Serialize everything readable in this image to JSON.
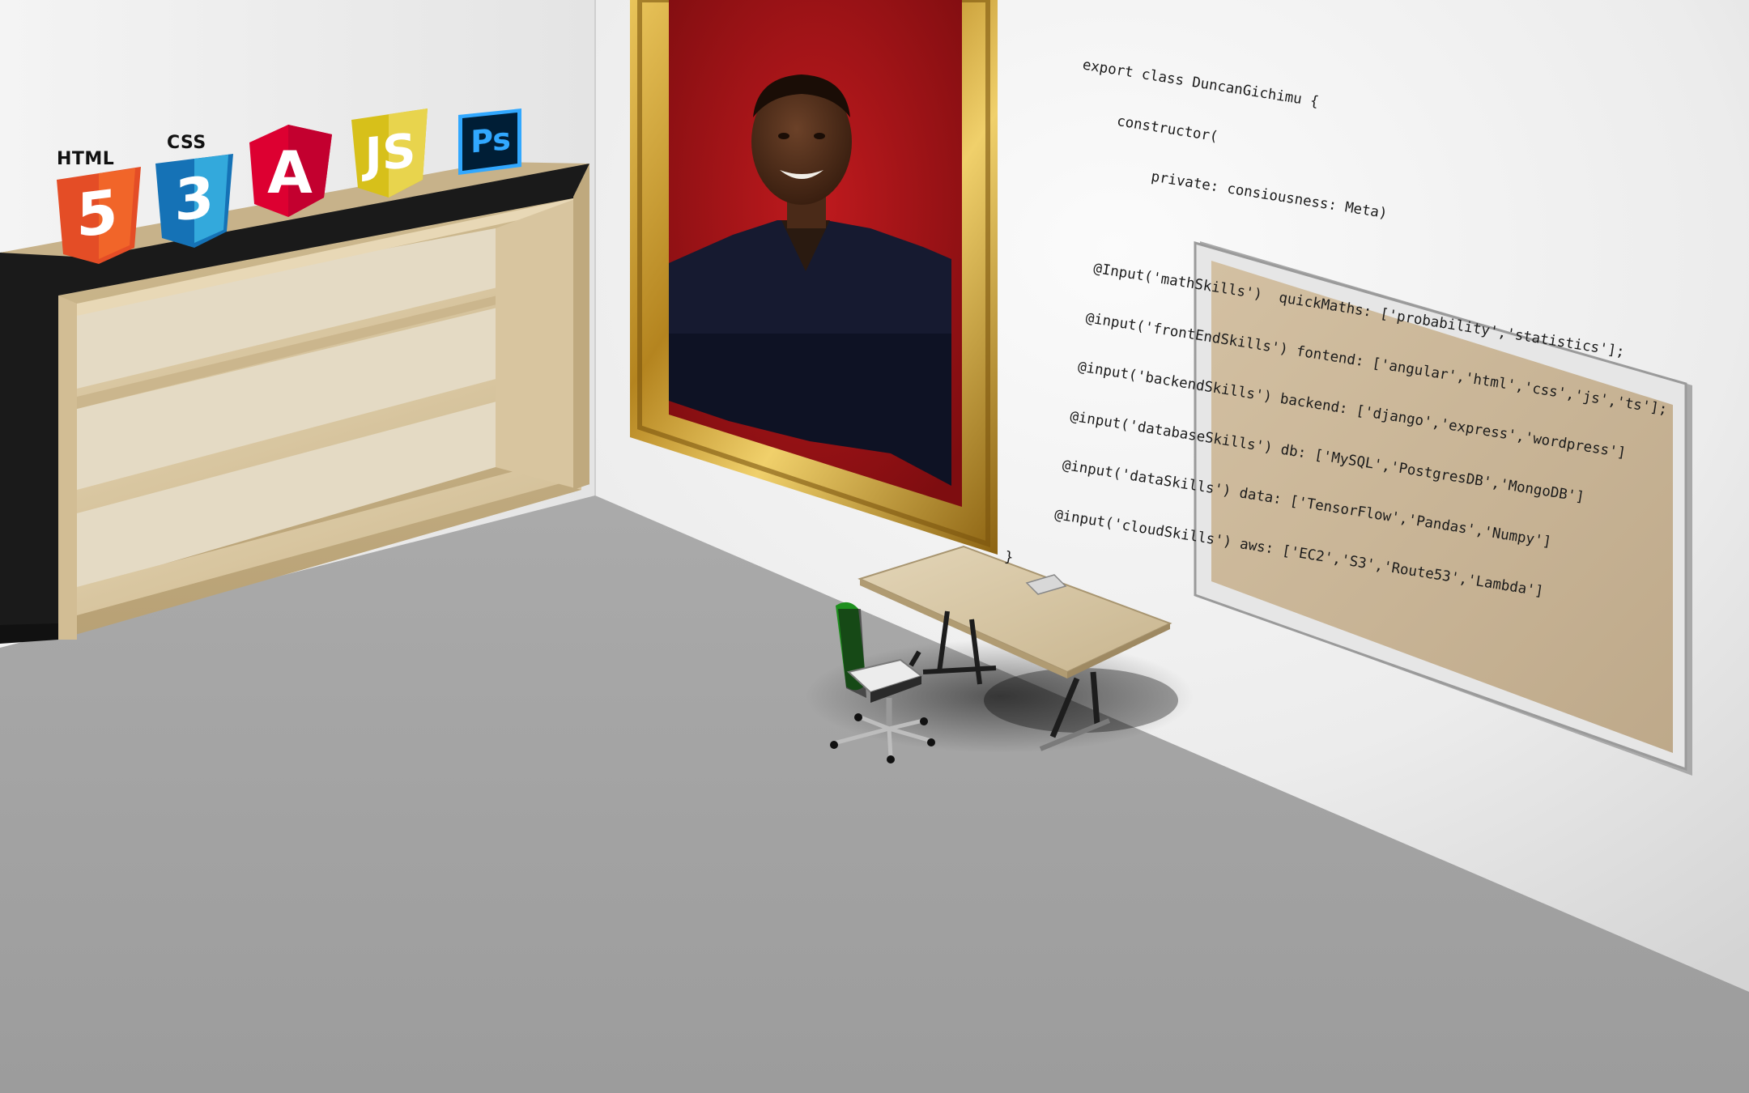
{
  "colors": {
    "wall_left": "#f3f3f3",
    "wall_right": "#e9e9e9",
    "floor": "#a8a8a8",
    "shelf_wood": "#dcc9a4",
    "frame_gold": "#c99a2e",
    "portrait_bg": "#a01418",
    "corkboard": "#c9b596",
    "html5_orange": "#e44d26",
    "css3_blue": "#1572b6",
    "angular_red": "#dd0031",
    "js_yellow": "#d7c01a",
    "ps_blue": "#31a8ff",
    "ps_bg": "#001e36",
    "chair_green": "#1e8f1e"
  },
  "logos": {
    "html": {
      "caption": "HTML",
      "glyph": "5"
    },
    "css": {
      "caption": "CSS",
      "glyph": "3"
    },
    "angular": {
      "glyph": "A"
    },
    "js": {
      "glyph": "JS"
    },
    "ps": {
      "glyph": "Ps"
    }
  },
  "code": {
    "lines": [
      "export class DuncanGichimu {",
      "     constructor(",
      "          private: consiousness: Meta)",
      "",
      "     @Input('mathSkills')  quickMaths: ['probability','statistics'];",
      "     @input('frontEndSkills') fontend: ['angular','html','css','js','ts'];",
      "     @input('backendSkills') backend: ['django','express','wordpress']",
      "     @input('databaseSkills') db: ['MySQL','PostgresDB','MongoDB']",
      "     @input('dataSkills') data: ['TensorFlow','Pandas','Numpy']",
      "     @input('cloudSkills') aws: ['EC2','S3','Route53','Lambda']",
      "}"
    ]
  },
  "icons": [
    "html5-icon",
    "css3-icon",
    "angular-icon",
    "javascript-icon",
    "photoshop-icon"
  ]
}
